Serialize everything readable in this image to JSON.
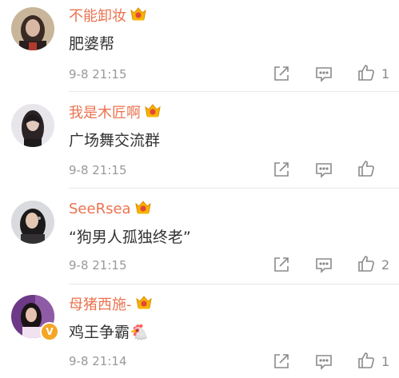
{
  "comments": [
    {
      "name": "不能卸妆",
      "text": "肥婆帮",
      "time": "9-8 21:15",
      "likes": "1",
      "verified": false,
      "avatar_colors": [
        "#c9b59a",
        "#3a2a24",
        "#d8b7a3",
        "#2a1f1e"
      ]
    },
    {
      "name": "我是木匠啊",
      "text": "广场舞交流群",
      "time": "9-8 21:15",
      "likes": "",
      "verified": false,
      "avatar_colors": [
        "#e8e6ea",
        "#2b2326",
        "#e2c9bd",
        "#1e1a1c"
      ]
    },
    {
      "name": "SeeRsea",
      "text": "“狗男人孤独终老”",
      "time": "9-8 21:15",
      "likes": "2",
      "verified": false,
      "avatar_colors": [
        "#d9dbde",
        "#1c1a1b",
        "#e4c7b3",
        "#323033"
      ]
    },
    {
      "name": "母猪西施-",
      "text": "鸡王争霸🐔",
      "time": "9-8 21:14",
      "likes": "1",
      "verified": true,
      "verified_symbol": "V",
      "avatar_colors": [
        "#6c3a86",
        "#1a1416",
        "#e7c2b0",
        "#f2e2f1"
      ]
    }
  ],
  "icons": {
    "repost": "share-edit-icon",
    "comment": "comment-bubble-icon",
    "like": "thumbs-up-icon",
    "badge": "crown-vip-icon"
  },
  "colors": {
    "name": "#eb7350",
    "text": "#333333",
    "time": "#999999",
    "icon": "#8a8a8a",
    "crown": "#f5b400",
    "crown_badge": "#e5453a"
  }
}
